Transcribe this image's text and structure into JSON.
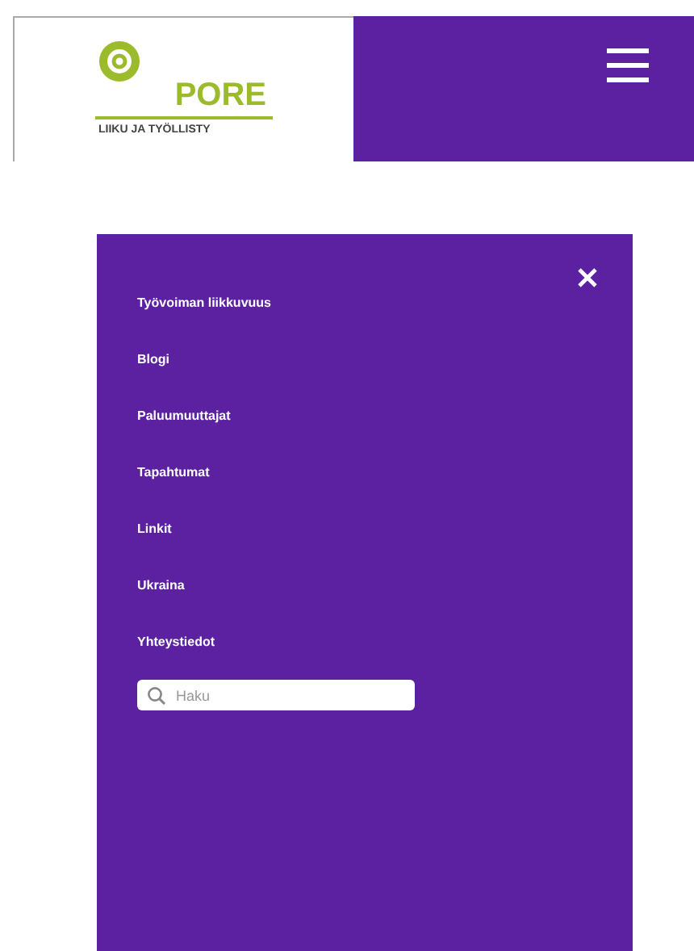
{
  "header": {
    "logo": {
      "name": "PORE",
      "tagline": "LIIKU JA TYÖLLISTY"
    }
  },
  "menu": {
    "items": [
      {
        "label": "Työvoiman liikkuvuus"
      },
      {
        "label": "Blogi"
      },
      {
        "label": "Paluumuuttajat"
      },
      {
        "label": "Tapahtumat"
      },
      {
        "label": "Linkit"
      },
      {
        "label": "Ukraina"
      },
      {
        "label": "Yhteystiedot"
      }
    ],
    "search": {
      "placeholder": "Haku"
    }
  }
}
